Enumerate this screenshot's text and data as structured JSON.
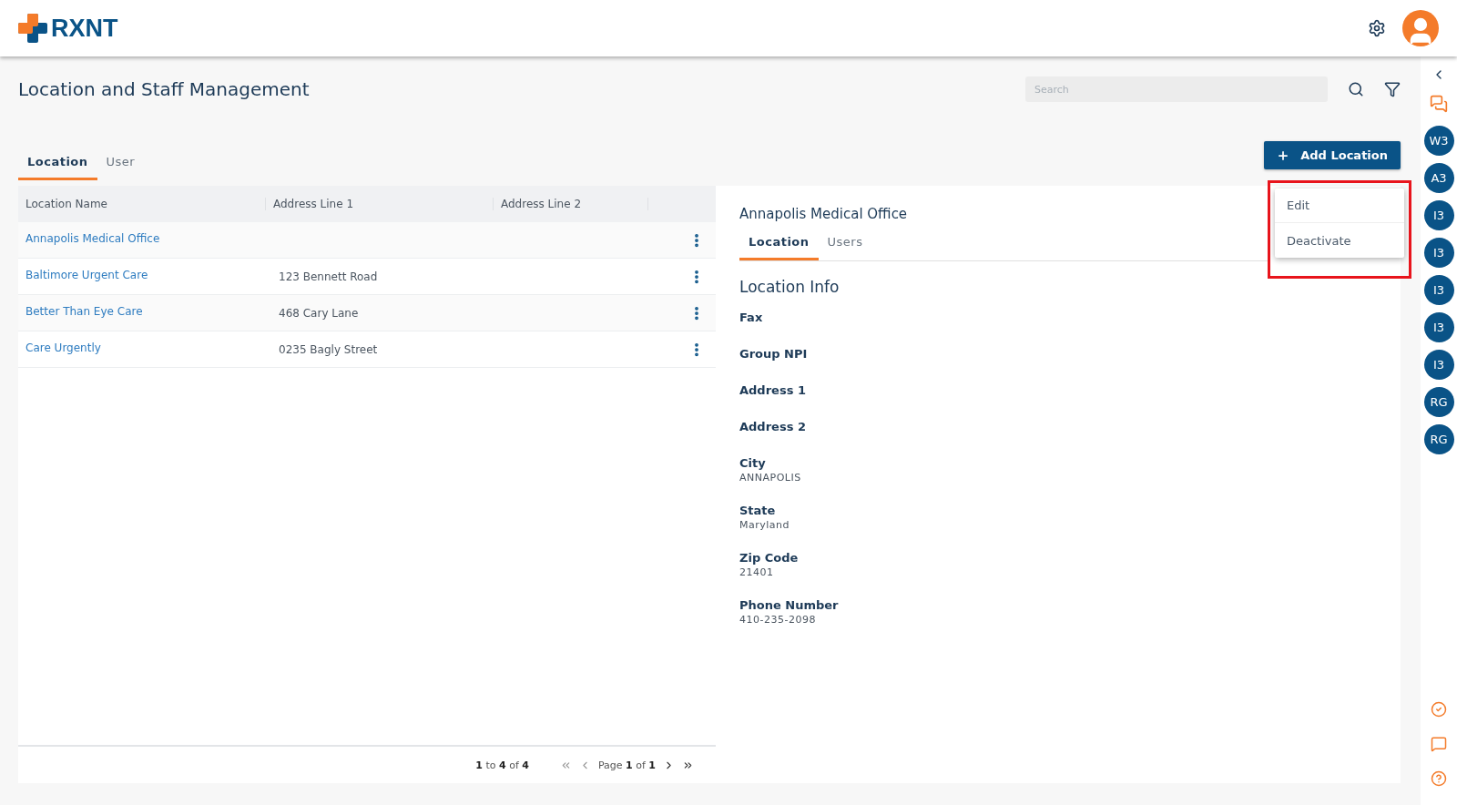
{
  "header": {
    "logo": "RXNT"
  },
  "page": {
    "title": "Location and Staff Management",
    "search": {
      "placeholder": "Search"
    },
    "tabs": [
      {
        "label": "Location",
        "selected": true
      },
      {
        "label": "User",
        "selected": false
      }
    ],
    "add_button": "Add Location"
  },
  "table": {
    "columns": [
      "Location Name",
      "Address Line 1",
      "Address Line 2"
    ],
    "rows": [
      {
        "name": "Annapolis Medical Office",
        "address_1": ""
      },
      {
        "name": "Baltimore Urgent Care",
        "address_1": "123 Bennett Road"
      },
      {
        "name": "Better Than Eye Care",
        "address_1": "468 Cary Lane"
      },
      {
        "name": "Care Urgently",
        "address_1": "0235 Bagly Street"
      }
    ]
  },
  "pagination": {
    "summary": "**1** to **4** of **4**",
    "page_info": "Page **1** of **1**"
  },
  "detail": {
    "title": "Annapolis Medical Office",
    "tabs": [
      {
        "label": "Location",
        "selected": true
      },
      {
        "label": "Users",
        "selected": false
      }
    ],
    "section_title": "Location Info",
    "fields": [
      {
        "label": "Fax"
      },
      {
        "label": "Group NPI"
      },
      {
        "label": "Address 1"
      },
      {
        "label": "Address 2"
      },
      {
        "label": "City",
        "value": "ANNAPOLIS"
      },
      {
        "label": "State",
        "value": "Maryland"
      },
      {
        "label": "Zip Code",
        "value": "21401"
      },
      {
        "label": "Phone Number",
        "value": "410-235-2098"
      }
    ]
  },
  "menu": {
    "items": [
      "Edit",
      "Deactivate"
    ]
  },
  "rail": {
    "avatars": [
      "W3",
      "A3",
      "I3",
      "I3",
      "I3",
      "I3",
      "I3",
      "RG",
      "RG"
    ]
  }
}
